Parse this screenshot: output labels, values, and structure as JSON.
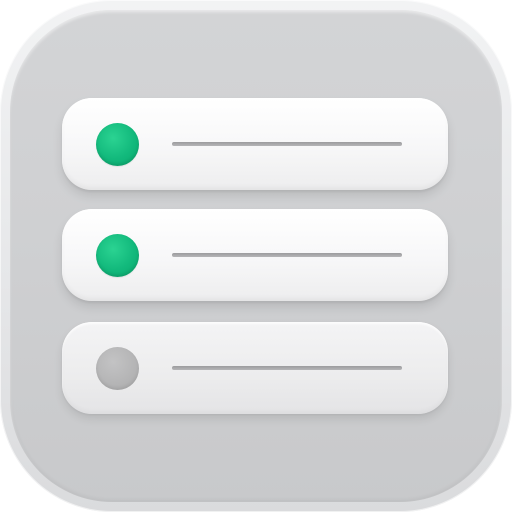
{
  "app_icon": {
    "icon_name": "checklist-icon",
    "colors": {
      "tile": "#cfd0d2",
      "row": "#f7f7f8",
      "active_dot": "#12b97c",
      "inactive_dot": "#b4b4b5",
      "line": "#a8a8aa"
    },
    "items": [
      {
        "state": "active",
        "dot_color": "#12b97c"
      },
      {
        "state": "active",
        "dot_color": "#12b97c"
      },
      {
        "state": "inactive",
        "dot_color": "#b4b4b5"
      }
    ]
  }
}
